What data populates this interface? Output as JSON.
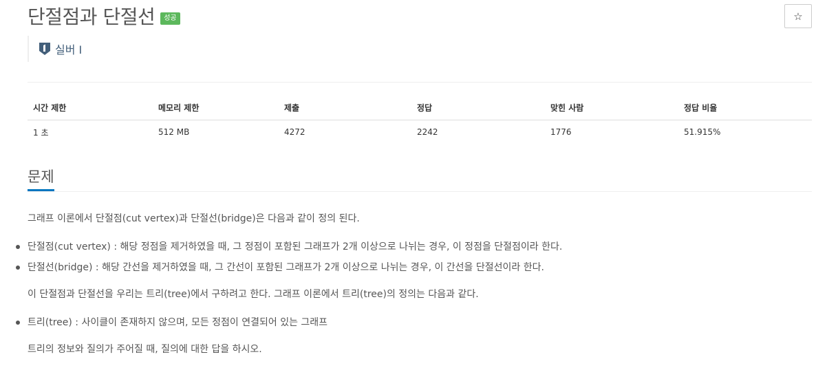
{
  "problem": {
    "title": "단절점과 단절선",
    "status_badge": "성공",
    "star_icon": "☆",
    "tier_label": "실버 I"
  },
  "stats": {
    "headers": [
      "시간 제한",
      "메모리 제한",
      "제출",
      "정답",
      "맞힌 사람",
      "정답 비율"
    ],
    "values": [
      "1 초",
      "512 MB",
      "4272",
      "2242",
      "1776",
      "51.915%"
    ]
  },
  "section": {
    "title": "문제",
    "intro": "그래프 이론에서 단절점(cut vertex)과 단절선(bridge)은 다음과 같이 정의 된다.",
    "bullets_1": [
      "단절점(cut vertex) : 해당 정점을 제거하였을 때, 그 정점이 포함된 그래프가 2개 이상으로 나뉘는 경우, 이 정점을 단절점이라 한다.",
      "단절선(bridge) : 해당 간선을 제거하였을 때, 그 간선이 포함된 그래프가 2개 이상으로 나뉘는 경우, 이 간선을 단절선이라 한다."
    ],
    "para_2": "이 단절점과 단절선을 우리는 트리(tree)에서 구하려고 한다. 그래프 이론에서 트리(tree)의 정의는 다음과 같다.",
    "bullets_2": [
      "트리(tree) : 사이클이 존재하지 않으며, 모든 정점이 연결되어 있는 그래프"
    ],
    "para_3": "트리의 정보와 질의가 주어질 때, 질의에 대한 답을 하시오."
  },
  "colors": {
    "badge_bg": "#5cb85c",
    "tier_color": "#435f7a",
    "section_underline": "#0076c0"
  }
}
